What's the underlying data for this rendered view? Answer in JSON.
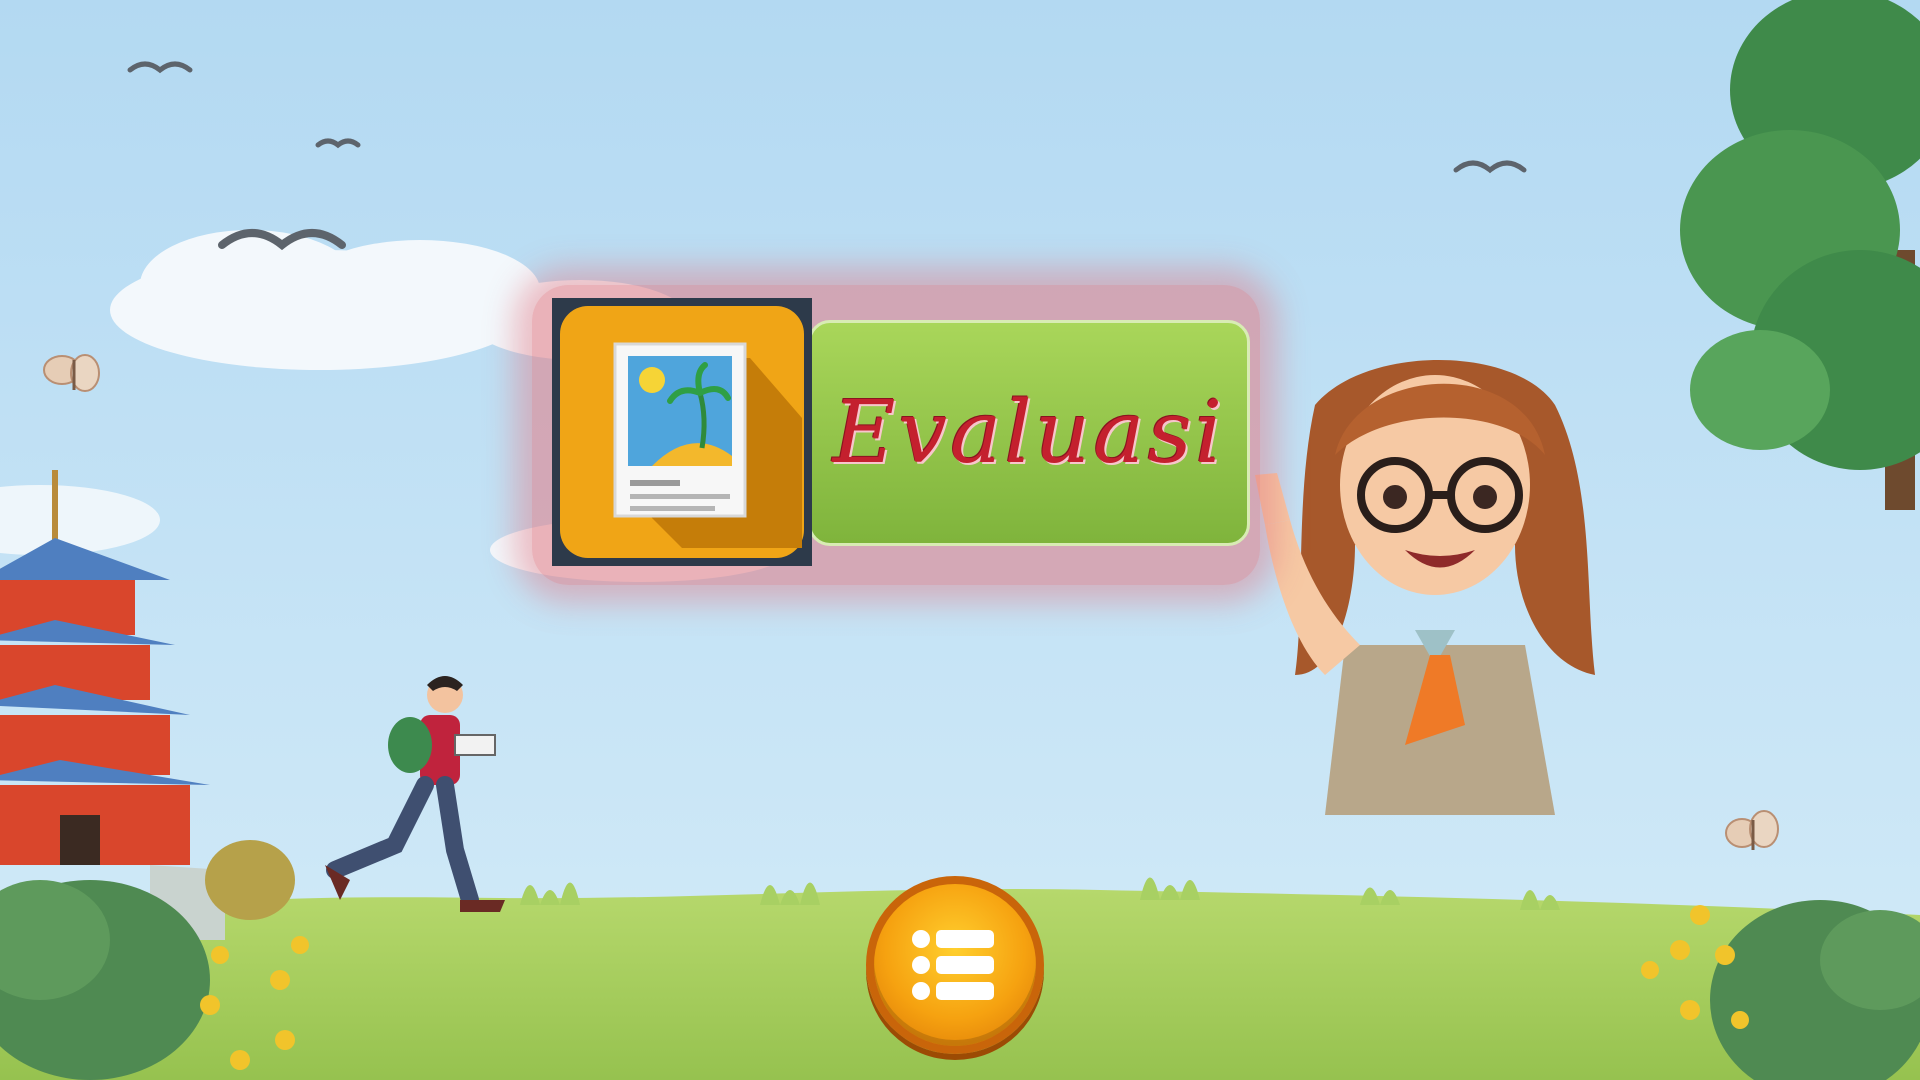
{
  "evaluation_button": {
    "label": "Evaluasi",
    "icon": "image-gallery-icon"
  },
  "menu_button": {
    "icon": "list-menu-icon"
  },
  "colors": {
    "sky": "#b9dcf2",
    "grass": "#a7cf5f",
    "label_green": "#8cc14a",
    "label_text": "#c4202e",
    "icon_orange": "#f0a516",
    "menu_orange": "#f6a210"
  }
}
